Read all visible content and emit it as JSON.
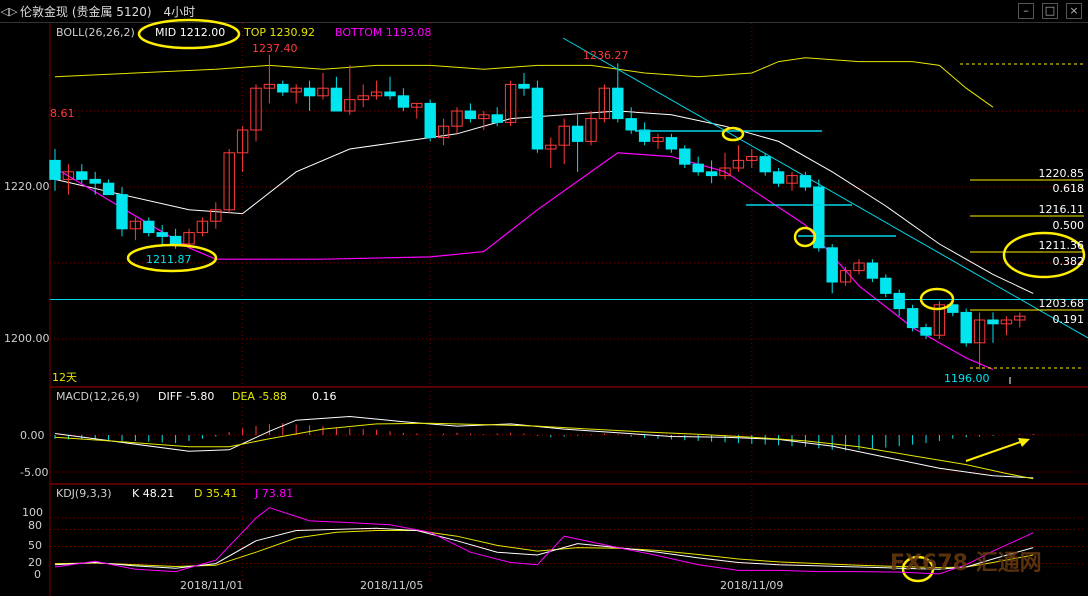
{
  "window": {
    "title": "伦敦金现 (贵金属 5120)",
    "period": "4小时",
    "icons": [
      "chart-back-icon",
      "minimize-icon",
      "restore-icon",
      "close-icon"
    ]
  },
  "colors": {
    "up": "#ff3b3b",
    "down": "#00e5ee",
    "boll_mid": "#ffffff",
    "boll_top": "#e6e600",
    "boll_bottom": "#ff00ff",
    "grid": "#7a0000",
    "annotation": "#ffee00",
    "fib": "#ffee00",
    "trend": "#00d8e8",
    "axis_text": "#cfcfcf"
  },
  "main_panel": {
    "legend": {
      "boll": "BOLL(26,26,2)",
      "mid": "MID 1212.00",
      "top": "TOP 1230.92",
      "bottom": "BOTTOM 1193.08"
    },
    "y_ticks": [
      "1220.00",
      "1200.00"
    ],
    "annotations": {
      "high1": "1237.40",
      "high2": "1236.27",
      "low1": "1211.87",
      "low_final": "1196.00",
      "left_partial": "8.61"
    },
    "fib_levels": [
      {
        "price": "1220.85",
        "ratio": "0.618"
      },
      {
        "price": "1216.11",
        "ratio": "0.500"
      },
      {
        "price": "1211.36",
        "ratio": "0.382"
      },
      {
        "price": "1203.68",
        "ratio": "0.191"
      }
    ],
    "period_label": "12天"
  },
  "macd_panel": {
    "name": "MACD(12,26,9)",
    "diff": "DIFF -5.80",
    "dea": "DEA -5.88",
    "macd": "0.16",
    "y_ticks": [
      "0.00",
      "-5.00"
    ]
  },
  "kdj_panel": {
    "name": "KDJ(9,3,3)",
    "k": "K 48.21",
    "d": "D 35.41",
    "j": "J 73.81",
    "y_ticks": [
      "100",
      "80",
      "50",
      "20",
      "0"
    ]
  },
  "x_axis": {
    "dates": [
      "2018/11/01",
      "2018/11/05",
      "2018/11/09"
    ]
  },
  "watermark": "FX678 汇通网",
  "chart_data": {
    "type": "candlestick",
    "ylim": [
      1196,
      1238
    ],
    "candles": [
      {
        "o": 1223.5,
        "h": 1225.0,
        "l": 1219.5,
        "c": 1221.0
      },
      {
        "o": 1221.0,
        "h": 1223.0,
        "l": 1219.0,
        "c": 1222.0
      },
      {
        "o": 1222.0,
        "h": 1223.0,
        "l": 1220.5,
        "c": 1221.0
      },
      {
        "o": 1221.0,
        "h": 1222.0,
        "l": 1219.0,
        "c": 1220.5
      },
      {
        "o": 1220.5,
        "h": 1221.0,
        "l": 1219.0,
        "c": 1219.0
      },
      {
        "o": 1219.0,
        "h": 1220.0,
        "l": 1213.5,
        "c": 1214.5
      },
      {
        "o": 1214.5,
        "h": 1216.0,
        "l": 1213.0,
        "c": 1215.5
      },
      {
        "o": 1215.5,
        "h": 1216.0,
        "l": 1213.5,
        "c": 1214.0
      },
      {
        "o": 1214.0,
        "h": 1215.0,
        "l": 1212.5,
        "c": 1213.5
      },
      {
        "o": 1213.5,
        "h": 1214.5,
        "l": 1211.87,
        "c": 1212.5
      },
      {
        "o": 1212.5,
        "h": 1214.5,
        "l": 1212.0,
        "c": 1214.0
      },
      {
        "o": 1214.0,
        "h": 1216.0,
        "l": 1213.5,
        "c": 1215.5
      },
      {
        "o": 1215.5,
        "h": 1218.0,
        "l": 1214.5,
        "c": 1217.0
      },
      {
        "o": 1217.0,
        "h": 1225.0,
        "l": 1216.5,
        "c": 1224.5
      },
      {
        "o": 1224.5,
        "h": 1228.0,
        "l": 1222.0,
        "c": 1227.5
      },
      {
        "o": 1227.5,
        "h": 1233.5,
        "l": 1226.0,
        "c": 1233.0
      },
      {
        "o": 1233.0,
        "h": 1237.4,
        "l": 1231.0,
        "c": 1233.5
      },
      {
        "o": 1233.5,
        "h": 1234.0,
        "l": 1232.0,
        "c": 1232.5
      },
      {
        "o": 1232.5,
        "h": 1233.5,
        "l": 1231.0,
        "c": 1233.0
      },
      {
        "o": 1233.0,
        "h": 1234.0,
        "l": 1230.0,
        "c": 1232.0
      },
      {
        "o": 1232.0,
        "h": 1235.0,
        "l": 1231.5,
        "c": 1233.0
      },
      {
        "o": 1233.0,
        "h": 1234.5,
        "l": 1232.0,
        "c": 1230.0
      },
      {
        "o": 1230.0,
        "h": 1236.0,
        "l": 1229.5,
        "c": 1231.5
      },
      {
        "o": 1231.5,
        "h": 1233.5,
        "l": 1230.5,
        "c": 1232.0
      },
      {
        "o": 1232.0,
        "h": 1234.0,
        "l": 1231.5,
        "c": 1232.5
      },
      {
        "o": 1232.5,
        "h": 1234.5,
        "l": 1231.5,
        "c": 1232.0
      },
      {
        "o": 1232.0,
        "h": 1233.0,
        "l": 1230.0,
        "c": 1230.5
      },
      {
        "o": 1230.5,
        "h": 1231.0,
        "l": 1229.0,
        "c": 1231.0
      },
      {
        "o": 1231.0,
        "h": 1231.5,
        "l": 1226.0,
        "c": 1226.5
      },
      {
        "o": 1226.5,
        "h": 1229.0,
        "l": 1225.5,
        "c": 1228.0
      },
      {
        "o": 1228.0,
        "h": 1230.5,
        "l": 1227.0,
        "c": 1230.0
      },
      {
        "o": 1230.0,
        "h": 1231.0,
        "l": 1228.5,
        "c": 1229.0
      },
      {
        "o": 1229.0,
        "h": 1230.0,
        "l": 1227.5,
        "c": 1229.5
      },
      {
        "o": 1229.5,
        "h": 1230.5,
        "l": 1228.0,
        "c": 1228.5
      },
      {
        "o": 1228.5,
        "h": 1234.0,
        "l": 1228.0,
        "c": 1233.5
      },
      {
        "o": 1233.5,
        "h": 1235.0,
        "l": 1232.0,
        "c": 1233.0
      },
      {
        "o": 1233.0,
        "h": 1234.0,
        "l": 1224.5,
        "c": 1225.0
      },
      {
        "o": 1225.0,
        "h": 1226.5,
        "l": 1222.5,
        "c": 1225.5
      },
      {
        "o": 1225.5,
        "h": 1229.0,
        "l": 1223.0,
        "c": 1228.0
      },
      {
        "o": 1228.0,
        "h": 1229.5,
        "l": 1222.0,
        "c": 1226.0
      },
      {
        "o": 1226.0,
        "h": 1230.0,
        "l": 1225.5,
        "c": 1229.0
      },
      {
        "o": 1229.0,
        "h": 1233.5,
        "l": 1228.5,
        "c": 1233.0
      },
      {
        "o": 1233.0,
        "h": 1236.27,
        "l": 1228.5,
        "c": 1229.0
      },
      {
        "o": 1229.0,
        "h": 1230.5,
        "l": 1227.0,
        "c": 1227.5
      },
      {
        "o": 1227.5,
        "h": 1228.5,
        "l": 1225.5,
        "c": 1226.0
      },
      {
        "o": 1226.0,
        "h": 1227.0,
        "l": 1225.0,
        "c": 1226.5
      },
      {
        "o": 1226.5,
        "h": 1227.0,
        "l": 1224.5,
        "c": 1225.0
      },
      {
        "o": 1225.0,
        "h": 1225.5,
        "l": 1222.5,
        "c": 1223.0
      },
      {
        "o": 1223.0,
        "h": 1224.0,
        "l": 1221.5,
        "c": 1222.0
      },
      {
        "o": 1222.0,
        "h": 1223.5,
        "l": 1220.5,
        "c": 1221.5
      },
      {
        "o": 1221.5,
        "h": 1224.5,
        "l": 1221.0,
        "c": 1222.5
      },
      {
        "o": 1222.5,
        "h": 1225.5,
        "l": 1222.0,
        "c": 1223.5
      },
      {
        "o": 1223.5,
        "h": 1225.0,
        "l": 1222.5,
        "c": 1224.0
      },
      {
        "o": 1224.0,
        "h": 1224.5,
        "l": 1221.5,
        "c": 1222.0
      },
      {
        "o": 1222.0,
        "h": 1222.5,
        "l": 1220.0,
        "c": 1220.5
      },
      {
        "o": 1220.5,
        "h": 1222.0,
        "l": 1219.5,
        "c": 1221.5
      },
      {
        "o": 1221.5,
        "h": 1222.0,
        "l": 1219.5,
        "c": 1220.0
      },
      {
        "o": 1220.0,
        "h": 1221.0,
        "l": 1211.5,
        "c": 1212.0
      },
      {
        "o": 1212.0,
        "h": 1212.5,
        "l": 1206.0,
        "c": 1207.5
      },
      {
        "o": 1207.5,
        "h": 1209.5,
        "l": 1207.0,
        "c": 1209.0
      },
      {
        "o": 1209.0,
        "h": 1210.5,
        "l": 1208.5,
        "c": 1210.0
      },
      {
        "o": 1210.0,
        "h": 1210.5,
        "l": 1207.5,
        "c": 1208.0
      },
      {
        "o": 1208.0,
        "h": 1208.5,
        "l": 1205.5,
        "c": 1206.0
      },
      {
        "o": 1206.0,
        "h": 1206.5,
        "l": 1203.0,
        "c": 1204.0
      },
      {
        "o": 1204.0,
        "h": 1204.5,
        "l": 1201.0,
        "c": 1201.5
      },
      {
        "o": 1201.5,
        "h": 1202.0,
        "l": 1200.0,
        "c": 1200.5
      },
      {
        "o": 1200.5,
        "h": 1205.0,
        "l": 1200.0,
        "c": 1204.5
      },
      {
        "o": 1204.5,
        "h": 1205.0,
        "l": 1203.0,
        "c": 1203.5
      },
      {
        "o": 1203.5,
        "h": 1204.0,
        "l": 1199.0,
        "c": 1199.5
      },
      {
        "o": 1199.5,
        "h": 1203.5,
        "l": 1196.0,
        "c": 1202.5
      },
      {
        "o": 1202.5,
        "h": 1203.5,
        "l": 1199.5,
        "c": 1202.0
      },
      {
        "o": 1202.0,
        "h": 1203.0,
        "l": 1200.5,
        "c": 1202.5
      },
      {
        "o": 1202.5,
        "h": 1203.5,
        "l": 1201.5,
        "c": 1203.0
      }
    ],
    "boll_mid": [
      [
        0,
        1221.0
      ],
      [
        10,
        1217.0
      ],
      [
        14,
        1216.5
      ],
      [
        18,
        1222.0
      ],
      [
        22,
        1225.0
      ],
      [
        26,
        1226.0
      ],
      [
        30,
        1227.0
      ],
      [
        34,
        1229.0
      ],
      [
        38,
        1229.5
      ],
      [
        42,
        1230.0
      ],
      [
        46,
        1229.5
      ],
      [
        50,
        1228.0
      ],
      [
        54,
        1226.0
      ],
      [
        58,
        1222.0
      ],
      [
        62,
        1217.5
      ],
      [
        66,
        1212.5
      ],
      [
        70,
        1208.5
      ],
      [
        73,
        1206.0
      ]
    ],
    "boll_top": [
      [
        0,
        1234.5
      ],
      [
        12,
        1235.5
      ],
      [
        16,
        1236.0
      ],
      [
        20,
        1235.5
      ],
      [
        24,
        1236.0
      ],
      [
        28,
        1236.0
      ],
      [
        32,
        1235.5
      ],
      [
        36,
        1236.0
      ],
      [
        40,
        1236.0
      ],
      [
        44,
        1235.0
      ],
      [
        48,
        1234.5
      ],
      [
        52,
        1235.0
      ],
      [
        54,
        1236.5
      ],
      [
        56,
        1237.0
      ],
      [
        60,
        1236.5
      ],
      [
        64,
        1236.5
      ],
      [
        66,
        1236.0
      ],
      [
        68,
        1233.0
      ],
      [
        70,
        1230.5
      ]
    ],
    "boll_bottom": [
      [
        0,
        1222.5
      ],
      [
        10,
        1212.0
      ],
      [
        12,
        1210.5
      ],
      [
        20,
        1210.5
      ],
      [
        28,
        1210.8
      ],
      [
        32,
        1211.5
      ],
      [
        36,
        1217.0
      ],
      [
        40,
        1222.0
      ],
      [
        42,
        1224.5
      ],
      [
        46,
        1224.0
      ],
      [
        50,
        1222.0
      ],
      [
        56,
        1215.0
      ],
      [
        60,
        1207.0
      ],
      [
        64,
        1201.5
      ],
      [
        68,
        1197.5
      ],
      [
        70,
        1196.0
      ]
    ],
    "macd": {
      "diff": [
        [
          0,
          0.2
        ],
        [
          5,
          -1.0
        ],
        [
          10,
          -2.2
        ],
        [
          13,
          -2.0
        ],
        [
          16,
          0.5
        ],
        [
          18,
          2.0
        ],
        [
          22,
          2.5
        ],
        [
          26,
          1.8
        ],
        [
          30,
          1.2
        ],
        [
          34,
          1.5
        ],
        [
          38,
          0.8
        ],
        [
          42,
          0.3
        ],
        [
          46,
          -0.2
        ],
        [
          50,
          -0.3
        ],
        [
          54,
          -0.6
        ],
        [
          58,
          -1.5
        ],
        [
          62,
          -3.0
        ],
        [
          66,
          -4.5
        ],
        [
          70,
          -5.5
        ],
        [
          73,
          -5.8
        ]
      ],
      "dea": [
        [
          0,
          -0.3
        ],
        [
          5,
          -0.9
        ],
        [
          10,
          -1.6
        ],
        [
          13,
          -1.6
        ],
        [
          16,
          -0.5
        ],
        [
          20,
          0.8
        ],
        [
          24,
          1.5
        ],
        [
          28,
          1.6
        ],
        [
          32,
          1.4
        ],
        [
          36,
          1.2
        ],
        [
          40,
          0.8
        ],
        [
          44,
          0.4
        ],
        [
          48,
          0.1
        ],
        [
          52,
          -0.3
        ],
        [
          56,
          -0.8
        ],
        [
          60,
          -1.6
        ],
        [
          64,
          -2.8
        ],
        [
          68,
          -4.0
        ],
        [
          71,
          -5.2
        ],
        [
          73,
          -5.9
        ]
      ],
      "bars": [
        -0.5,
        -0.6,
        -0.5,
        -0.6,
        -0.7,
        -0.8,
        -0.8,
        -0.9,
        -1.0,
        -1.1,
        -0.8,
        -0.5,
        -0.2,
        0.4,
        0.9,
        1.2,
        1.5,
        1.6,
        1.4,
        1.3,
        1.2,
        1.0,
        0.9,
        0.8,
        0.7,
        0.5,
        0.3,
        0.2,
        0.1,
        0.2,
        0.3,
        0.2,
        0.1,
        0.2,
        0.3,
        0.2,
        -0.1,
        -0.3,
        -0.2,
        -0.1,
        0.1,
        0.2,
        0.1,
        -0.2,
        -0.4,
        -0.5,
        -0.6,
        -0.7,
        -0.8,
        -0.9,
        -1.0,
        -1.1,
        -1.2,
        -1.3,
        -1.4,
        -1.5,
        -1.6,
        -1.8,
        -2.0,
        -2.1,
        -2.0,
        -1.9,
        -1.7,
        -1.5,
        -1.3,
        -1.1,
        -0.8,
        -0.5,
        -0.3,
        -0.2,
        -0.1,
        0.0,
        0.1,
        0.16
      ]
    },
    "kdj": {
      "k": [
        [
          0,
          18
        ],
        [
          3,
          22
        ],
        [
          6,
          16
        ],
        [
          9,
          12
        ],
        [
          12,
          20
        ],
        [
          15,
          60
        ],
        [
          18,
          78
        ],
        [
          21,
          80
        ],
        [
          24,
          82
        ],
        [
          27,
          78
        ],
        [
          30,
          60
        ],
        [
          33,
          40
        ],
        [
          36,
          35
        ],
        [
          39,
          55
        ],
        [
          42,
          48
        ],
        [
          45,
          40
        ],
        [
          48,
          30
        ],
        [
          51,
          22
        ],
        [
          54,
          18
        ],
        [
          57,
          16
        ],
        [
          60,
          14
        ],
        [
          63,
          12
        ],
        [
          66,
          10
        ],
        [
          68,
          14
        ],
        [
          70,
          28
        ],
        [
          73,
          48
        ]
      ],
      "d": [
        [
          0,
          20
        ],
        [
          3,
          21
        ],
        [
          6,
          18
        ],
        [
          9,
          15
        ],
        [
          12,
          17
        ],
        [
          15,
          40
        ],
        [
          18,
          65
        ],
        [
          21,
          75
        ],
        [
          24,
          78
        ],
        [
          27,
          78
        ],
        [
          30,
          68
        ],
        [
          33,
          52
        ],
        [
          36,
          42
        ],
        [
          39,
          48
        ],
        [
          42,
          47
        ],
        [
          45,
          43
        ],
        [
          48,
          36
        ],
        [
          51,
          28
        ],
        [
          54,
          23
        ],
        [
          57,
          20
        ],
        [
          60,
          17
        ],
        [
          63,
          15
        ],
        [
          66,
          13
        ],
        [
          68,
          14
        ],
        [
          70,
          22
        ],
        [
          73,
          35
        ]
      ],
      "j": [
        [
          0,
          14
        ],
        [
          3,
          24
        ],
        [
          6,
          10
        ],
        [
          9,
          6
        ],
        [
          12,
          26
        ],
        [
          15,
          100
        ],
        [
          16,
          118
        ],
        [
          19,
          95
        ],
        [
          22,
          92
        ],
        [
          25,
          88
        ],
        [
          28,
          75
        ],
        [
          31,
          40
        ],
        [
          34,
          22
        ],
        [
          36,
          18
        ],
        [
          38,
          68
        ],
        [
          40,
          58
        ],
        [
          42,
          48
        ],
        [
          45,
          34
        ],
        [
          48,
          18
        ],
        [
          51,
          8
        ],
        [
          54,
          8
        ],
        [
          57,
          6
        ],
        [
          60,
          6
        ],
        [
          63,
          5
        ],
        [
          66,
          2
        ],
        [
          68,
          18
        ],
        [
          70,
          42
        ],
        [
          73,
          74
        ]
      ]
    }
  }
}
